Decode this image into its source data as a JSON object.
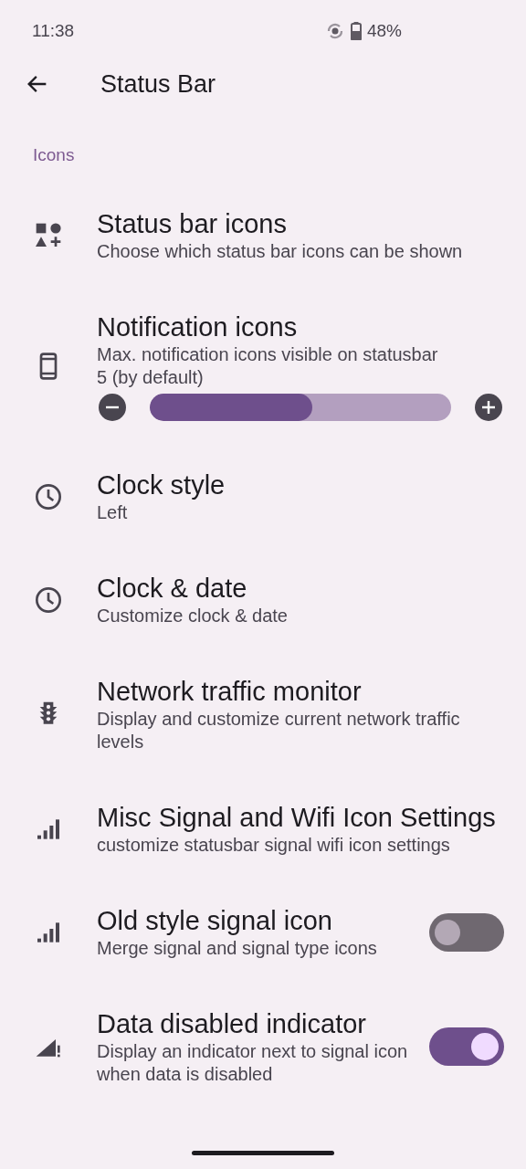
{
  "status_bar": {
    "time": "11:38",
    "battery": "48%"
  },
  "app_bar": {
    "title": "Status Bar"
  },
  "section": {
    "title": "Icons"
  },
  "items": [
    {
      "kind": "plain",
      "title": "Status bar icons",
      "summary": "Choose which status bar icons can be shown"
    },
    {
      "kind": "slider",
      "title": "Notification icons",
      "summary": "Max. notification icons visible on statusbar",
      "value": "5 (by default)",
      "level": 0.54
    },
    {
      "kind": "plain",
      "title": "Clock style",
      "summary": "Left"
    },
    {
      "kind": "plain",
      "title": "Clock & date",
      "summary": "Customize clock & date"
    },
    {
      "kind": "plain",
      "title": "Network traffic monitor",
      "summary": "Display and customize current network traffic levels"
    },
    {
      "kind": "plain",
      "title": "Misc Signal and Wifi Icon Settings",
      "summary": "customize statusbar signal wifi icon settings"
    },
    {
      "kind": "switch",
      "title": "Old style signal icon",
      "summary": "Merge signal and signal type icons",
      "on": false
    },
    {
      "kind": "switch",
      "title": "Data disabled indicator",
      "summary": "Display an indicator next to signal icon when data is disabled",
      "on": true
    }
  ]
}
